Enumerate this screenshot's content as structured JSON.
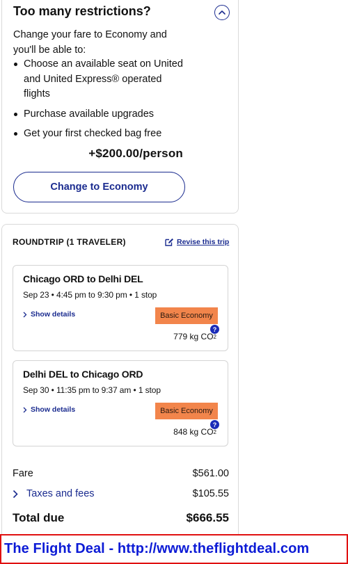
{
  "restrictions": {
    "title": "Too many restrictions?",
    "intro": "Change your fare to Economy and you'll be able to:",
    "benefits": [
      "Choose an available seat on United and United Express® operated flights",
      "Purchase available upgrades",
      "Get your first checked bag free"
    ],
    "price": "+$200.00/person",
    "button_label": "Change to Economy"
  },
  "trip": {
    "heading": "ROUNDTRIP (1 TRAVELER)",
    "revise_label": "Revise this trip",
    "flights": [
      {
        "route": "Chicago ORD to Delhi DEL",
        "times": "Sep 23 • 4:45 pm to 9:30 pm • 1 stop",
        "details_label": "Show details",
        "fare_class": "Basic Economy",
        "co2_value": "779 kg CO",
        "co2_sub": "2",
        "help_glyph": "?"
      },
      {
        "route": "Delhi DEL to Chicago ORD",
        "times": "Sep 30 • 11:35 pm to 9:37 am • 1 stop",
        "details_label": "Show details",
        "fare_class": "Basic Economy",
        "co2_value": "848 kg CO",
        "co2_sub": "2",
        "help_glyph": "?"
      }
    ]
  },
  "summary": {
    "fare_label": "Fare",
    "fare_value": "$561.00",
    "taxes_label": "Taxes and fees",
    "taxes_value": "$105.55",
    "total_label": "Total due",
    "total_value": "$666.55"
  },
  "banner": {
    "text": "The Flight Deal - http://www.theflightdeal.com"
  },
  "colors": {
    "accent": "#1a2b8f",
    "badge": "#f2854b",
    "banner_text": "#0c1bd6",
    "banner_border": "#e01010"
  },
  "icons": [
    "chevron-up-icon",
    "edit-icon",
    "chevron-right-icon",
    "help-icon"
  ]
}
